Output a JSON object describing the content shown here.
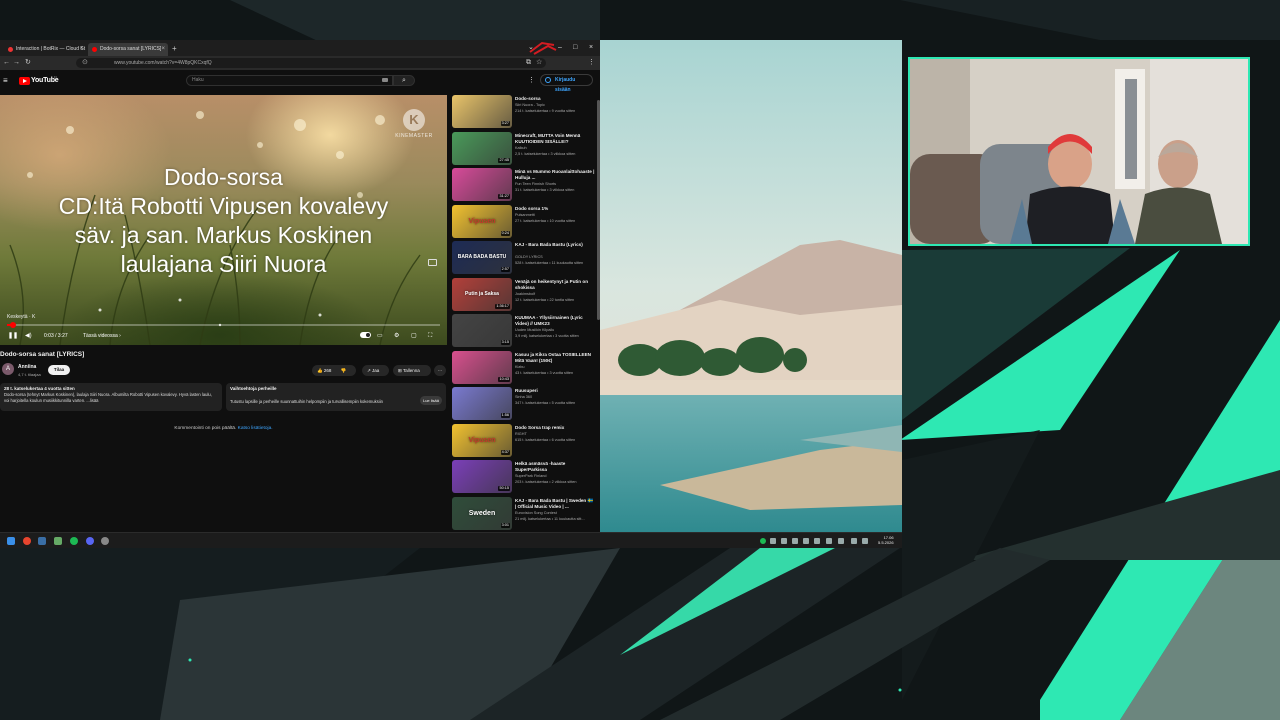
{
  "colors": {
    "accent": "#2ee8b3",
    "yt_red": "#ff0000",
    "link_blue": "#3ea6ff"
  },
  "browser": {
    "tabs": [
      {
        "label": "Interaction | BotRix — Cloud St"
      },
      {
        "label": "Dodo-sorsa sanat [LYRICS]"
      }
    ],
    "url": "www.youtube.com/watch?v=4W8pQKCxqfQ"
  },
  "youtube": {
    "logo_text": "YouTube",
    "country": "FI",
    "search_placeholder": "Haku",
    "sign_in": "Kirjaudu sisään",
    "player": {
      "lines": [
        "Dodo-sorsa",
        "CD:Itä Robotti Vipusen kovalevy",
        "säv. ja san. Markus Koskinen",
        "laulajana Siiri Nuora"
      ],
      "watermark": "KINEMASTER",
      "label": "Keskeytä · K",
      "time": "0:03 / 3:27",
      "chapter": "Tässä videossa ›",
      "progress": 0.015
    },
    "video_title": "Dodo-sorsa sanat [LYRICS]",
    "channel": {
      "avatar_letter": "A",
      "name": "Anniina",
      "subs": "4,7 t. tilaajaa",
      "subscribe": "Tilaa"
    },
    "actions": {
      "likes": "268",
      "share": "Jaa",
      "save": "Tallenna",
      "more": "···"
    },
    "description": {
      "meta": "28 t. katselukertaa  4 vuotta sitten",
      "text": "Dodo-sorsa (tehnyt Markus Koskinen), laulaja Siiri Nuora. Albumilta Robotti Vipusen kovalevy. Hyvä lasten laulu, voi harjoitella koulun musiikkitunnilla varten. ...lisää"
    },
    "alternative": {
      "title": "Vaihtoehtoja perheille",
      "text": "Tutustu lapsille ja perheille suunnattuihin helpompiin ja turvallisempiin kokemuksiin",
      "button": "Lue lisää"
    },
    "comments_off": "Kommentointi on pois päältä.",
    "comments_link": "Katso lisätietoja."
  },
  "recommendations": [
    {
      "title": "Dodo-sorsa",
      "channel": "Siiri Nuora - Topic",
      "meta": "214 t. katselukertaa • 9 vuotta sitten",
      "duration": "3:27",
      "thumb_text": "",
      "thumb_color": "#e9c46a"
    },
    {
      "title": "Minecraft, MUTTA Voin Mennä KUUTIOIDEN SISÄLLE!?",
      "channel": "Kalkuh",
      "meta": "2,5 t. katselukertaa • 3 viikkoa sitten",
      "duration": "27:45",
      "thumb_text": "",
      "thumb_color": "#4a9a5a"
    },
    {
      "title": "Minä vs Mummo Ruoanlaittohaaste | Hulluja ...",
      "channel": "Fun Teen Finnish Shorts",
      "meta": "31 t. katselukertaa • 3 viikkoa sitten",
      "duration": "31:27",
      "thumb_text": "",
      "thumb_color": "#d84b9a"
    },
    {
      "title": "Dodo sorsa 1%",
      "channel": "Pulsanmetti",
      "meta": "27 t. katselukertaa • 10 vuotta sitten",
      "duration": "0:24",
      "thumb_text": "Vipusen",
      "thumb_color": "#f2c230"
    },
    {
      "title": "KAJ - Bara Bada Bastu (Lyrics)",
      "channel": "GOLDY LYRICS",
      "meta": "528 t. katselukertaa • 11 kuukautta sitten",
      "duration": "2:57",
      "thumb_text": "BARA BADA BASTU",
      "thumb_color": "#1d2b55"
    },
    {
      "title": "Venäjä on heikentynyt ja Putin on shokissa",
      "channel": "Joakimsbolf",
      "meta": "12 t. katselukertaa • 22 tuntia sitten",
      "duration": "1:36:17",
      "thumb_text": "Putin ja Saksa",
      "thumb_color": "#b3403a"
    },
    {
      "title": "KUUMAA - Yllysiirnainen (Lyric Video) // UMK23",
      "channel": "Uuden Musiikin Kilpailu",
      "meta": "3,9 milj. katselukertaa • 3 vuotta sitten",
      "duration": "3:15",
      "thumb_text": "",
      "thumb_color": "#444444"
    },
    {
      "title": "Kasuu ja Kikra Ostaa TOSIELLEEN Mitä Vaan! (150€)",
      "channel": "Kizbu",
      "meta": "43 t. katselukertaa • 3 vuotta sitten",
      "duration": "10:43",
      "thumb_text": "",
      "thumb_color": "#d8508e"
    },
    {
      "title": "Ruusuperi",
      "channel": "Sinha 360",
      "meta": "347 t. katselukertaa • 5 vuotta sitten",
      "duration": "1:56",
      "thumb_text": "",
      "thumb_color": "#7a7ad0"
    },
    {
      "title": "Dodo Sorsa trap remix",
      "channel": "RIGHT",
      "meta": "615 t. katselukertaa • 6 vuotta sitten",
      "duration": "4:37",
      "thumb_text": "Vipusen",
      "thumb_color": "#f2c230"
    },
    {
      "title": "Helkä asmäsvä -haaste SuperParkissa",
      "channel": "SuperPark Finland",
      "meta": "203 t. katselukertaa • 2 viikkoa sitten",
      "duration": "50:15",
      "thumb_text": "",
      "thumb_color": "#7b3fb8"
    },
    {
      "title": "KAJ - Bara Bada Bastu | Sweden 🇸🇪 | Official Music Video | ...",
      "channel": "Eurovision Song Contest",
      "meta": "21 milj. katselukertaa • 11 kuukautta sitt...",
      "duration": "3:01",
      "thumb_text": "Sweden",
      "thumb_color": "#2f4d3a"
    }
  ],
  "taskbar": {
    "time": "17.06",
    "date": "5.5.2026"
  }
}
